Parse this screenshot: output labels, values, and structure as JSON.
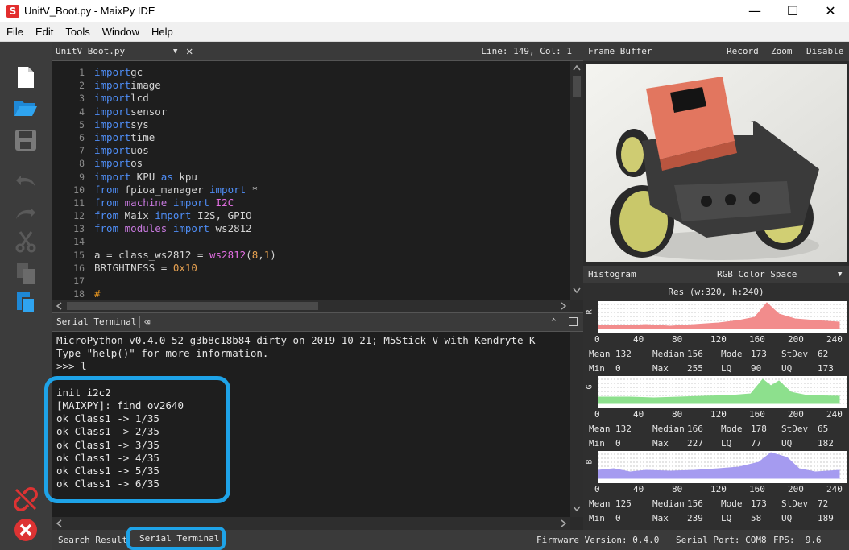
{
  "window": {
    "app_icon_letter": "S",
    "title": "UnitV_Boot.py - MaixPy IDE",
    "minimize": "—",
    "maximize": "☐",
    "close": "✕"
  },
  "menu": [
    "File",
    "Edit",
    "Tools",
    "Window",
    "Help"
  ],
  "toolbar_icons": [
    "new-file-icon",
    "open-folder-icon",
    "save-icon",
    "undo-icon",
    "redo-icon",
    "cut-icon",
    "copy-icon",
    "paste-icon",
    "disconnect-icon",
    "stop-icon"
  ],
  "editor": {
    "file_name": "UnitV_Boot.py",
    "position": "Line: 149, Col: 1",
    "line_numbers": [
      "1",
      "2",
      "3",
      "4",
      "5",
      "6",
      "7",
      "8",
      "9",
      "10",
      "11",
      "12",
      "13",
      "14",
      "15",
      "16",
      "17",
      "18"
    ],
    "code_lines": [
      [
        [
          "kw",
          "import"
        ],
        [
          "",
          "gc"
        ]
      ],
      [
        [
          "kw",
          "import"
        ],
        [
          "",
          "image"
        ]
      ],
      [
        [
          "kw",
          "import"
        ],
        [
          "",
          "lcd"
        ]
      ],
      [
        [
          "kw",
          "import"
        ],
        [
          "",
          "sensor"
        ]
      ],
      [
        [
          "kw",
          "import"
        ],
        [
          "",
          "sys"
        ]
      ],
      [
        [
          "kw",
          "import"
        ],
        [
          "",
          "time"
        ]
      ],
      [
        [
          "kw",
          "import"
        ],
        [
          "",
          "uos"
        ]
      ],
      [
        [
          "kw",
          "import"
        ],
        [
          "",
          "os"
        ]
      ],
      [
        [
          "kw",
          "import"
        ],
        [
          "",
          " KPU "
        ],
        [
          "kw",
          "as"
        ],
        [
          "",
          " kpu"
        ]
      ],
      [
        [
          "kw",
          "from"
        ],
        [
          "",
          " fpioa_manager "
        ],
        [
          "kw",
          "import"
        ],
        [
          "",
          " *"
        ]
      ],
      [
        [
          "kw",
          "from"
        ],
        [
          "",
          " "
        ],
        [
          "kw2",
          "machine"
        ],
        [
          "",
          " "
        ],
        [
          "kw",
          "import"
        ],
        [
          "",
          " "
        ],
        [
          "fn",
          "I2C"
        ]
      ],
      [
        [
          "kw",
          "from"
        ],
        [
          "",
          " Maix "
        ],
        [
          "kw",
          "import"
        ],
        [
          "",
          " I2S, GPIO"
        ]
      ],
      [
        [
          "kw",
          "from"
        ],
        [
          "",
          " "
        ],
        [
          "kw2",
          "modules"
        ],
        [
          "",
          " "
        ],
        [
          "kw",
          "import"
        ],
        [
          "",
          " ws2812"
        ]
      ],
      [],
      [
        [
          "",
          "a = class_ws2812 = "
        ],
        [
          "fn",
          "ws2812"
        ],
        [
          "",
          "("
        ],
        [
          "num",
          "8"
        ],
        [
          "",
          ","
        ],
        [
          "num",
          "1"
        ],
        [
          "",
          ")"
        ]
      ],
      [
        [
          "",
          "BRIGHTNESS = "
        ],
        [
          "num",
          "0x10"
        ]
      ],
      [],
      [
        [
          "cm",
          "#"
        ]
      ]
    ]
  },
  "terminal": {
    "title": "Serial Terminal",
    "lines": [
      "MicroPython v0.4.0-52-g3b8c18b84-dirty on 2019-10-21; M5Stick-V with Kendryte K",
      "Type \"help()\" for more information.",
      ">>> l",
      "",
      "init i2c2",
      "[MAIXPY]: find ov2640",
      "ok Class1 -> 1/35",
      "ok Class1 -> 2/35",
      "ok Class1 -> 3/35",
      "ok Class1 -> 4/35",
      "ok Class1 -> 5/35",
      "ok Class1 -> 6/35"
    ]
  },
  "status": {
    "search_results": "Search Results",
    "serial_terminal": "Serial Terminal",
    "firmware": "Firmware Version: 0.4.0",
    "serial_port": "Serial Port: COM8",
    "fps": "FPS:  9.6"
  },
  "frame_buffer": {
    "title": "Frame Buffer",
    "record": "Record",
    "zoom": "Zoom",
    "disable": "Disable"
  },
  "histogram": {
    "title": "Histogram",
    "color_space": "RGB Color Space",
    "resolution": "Res (w:320, h:240)",
    "ticks": [
      "0",
      "40",
      "80",
      "120",
      "160",
      "200",
      "240"
    ],
    "channels": [
      {
        "label": "R",
        "color": "#f28c8c",
        "mean": "132",
        "median": "156",
        "mode": "173",
        "stdev": "62",
        "min": "0",
        "max": "255",
        "lq": "90",
        "uq": "173"
      },
      {
        "label": "G",
        "color": "#8de08d",
        "mean": "132",
        "median": "166",
        "mode": "178",
        "stdev": "65",
        "min": "0",
        "max": "227",
        "lq": "77",
        "uq": "182"
      },
      {
        "label": "B",
        "color": "#a59bf0",
        "mean": "125",
        "median": "156",
        "mode": "173",
        "stdev": "72",
        "min": "0",
        "max": "239",
        "lq": "58",
        "uq": "189"
      }
    ],
    "stat_labels": {
      "mean": "Mean",
      "median": "Median",
      "mode": "Mode",
      "stdev": "StDev",
      "min": "Min",
      "max": "Max",
      "lq": "LQ",
      "uq": "UQ"
    }
  },
  "colors": {
    "highlight": "#1ea3e8",
    "keyword": "#4f8ef7",
    "background": "#1e1e1e"
  }
}
